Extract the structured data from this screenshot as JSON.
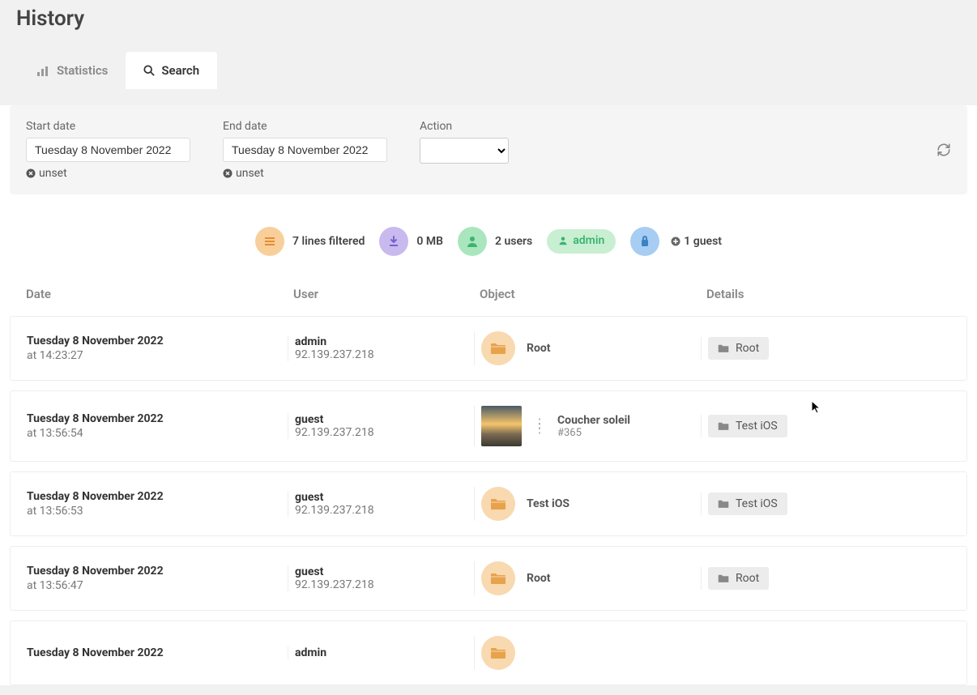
{
  "page": {
    "title": "History"
  },
  "tabs": {
    "statistics": "Statistics",
    "search": "Search"
  },
  "filters": {
    "start_label": "Start date",
    "start_value": "Tuesday 8 November 2022",
    "end_label": "End date",
    "end_value": "Tuesday 8 November 2022",
    "action_label": "Action",
    "unset_label": "unset"
  },
  "stats": {
    "lines": "7 lines filtered",
    "size": "0 MB",
    "users": "2 users",
    "admin_badge": "admin",
    "guests": "1 guest"
  },
  "columns": {
    "date": "Date",
    "user": "User",
    "object": "Object",
    "details": "Details"
  },
  "rows": [
    {
      "date": "Tuesday 8 November 2022",
      "time": "at 14:23:27",
      "user": "admin",
      "ip": "92.139.237.218",
      "obj_type": "folder",
      "obj_title": "Root",
      "obj_sub": "",
      "detail": "Root"
    },
    {
      "date": "Tuesday 8 November 2022",
      "time": "at 13:56:54",
      "user": "guest",
      "ip": "92.139.237.218",
      "obj_type": "image",
      "obj_title": "Coucher soleil",
      "obj_sub": "#365",
      "detail": "Test iOS"
    },
    {
      "date": "Tuesday 8 November 2022",
      "time": "at 13:56:53",
      "user": "guest",
      "ip": "92.139.237.218",
      "obj_type": "folder",
      "obj_title": "Test iOS",
      "obj_sub": "",
      "detail": "Test iOS"
    },
    {
      "date": "Tuesday 8 November 2022",
      "time": "at 13:56:47",
      "user": "guest",
      "ip": "92.139.237.218",
      "obj_type": "folder",
      "obj_title": "Root",
      "obj_sub": "",
      "detail": "Root"
    },
    {
      "date": "Tuesday 8 November 2022",
      "time": "",
      "user": "admin",
      "ip": "",
      "obj_type": "folder",
      "obj_title": "",
      "obj_sub": "",
      "detail": ""
    }
  ]
}
